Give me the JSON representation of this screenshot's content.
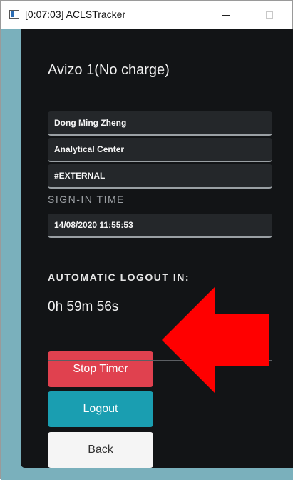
{
  "window": {
    "title": "[0:07:03] ACLSTracker"
  },
  "instrument": {
    "name": "Avizo 1(No charge)"
  },
  "user": {
    "name": "Dong Ming Zheng",
    "department": "Analytical Center",
    "account": "#EXTERNAL"
  },
  "signin": {
    "label": "SIGN-IN TIME",
    "value": "14/08/2020 11:55:53"
  },
  "logout_timer": {
    "label": "AUTOMATIC LOGOUT IN:",
    "value": "0h 59m 56s"
  },
  "buttons": {
    "stop_timer": "Stop Timer",
    "logout": "Logout",
    "back": "Back"
  },
  "colors": {
    "panel_bg": "#121416",
    "stop_button": "#e0414f",
    "logout_button": "#1a9eb1",
    "back_button": "#f5f5f5",
    "annotation_arrow": "#ff0000"
  },
  "icons": [
    "app-icon",
    "minimize-icon",
    "maximize-icon"
  ]
}
